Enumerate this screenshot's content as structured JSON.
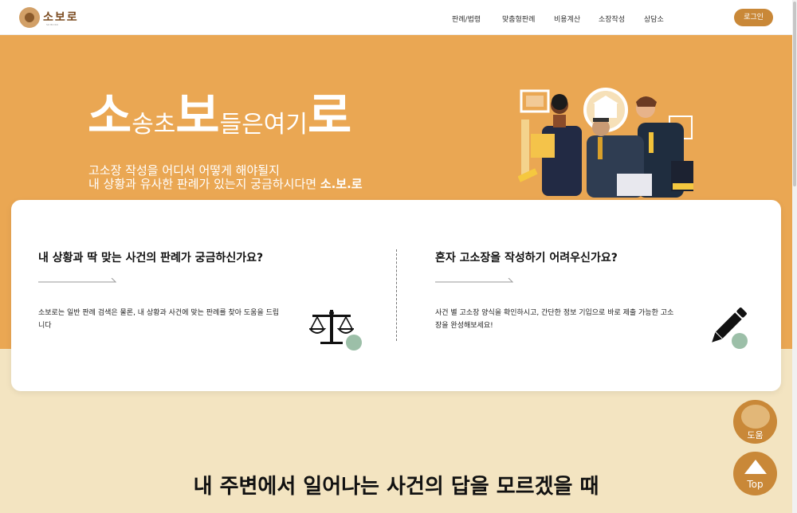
{
  "header": {
    "logo_text": "소보로",
    "logo_sub": "SO BO RO",
    "nav": [
      "판례/법령",
      "맞춤형판례",
      "비용계산",
      "소장작성",
      "상담소"
    ],
    "login": "로그인"
  },
  "hero": {
    "title_parts": [
      {
        "text": "소",
        "size": "big"
      },
      {
        "text": "송초",
        "size": "small"
      },
      {
        "text": "보",
        "size": "big"
      },
      {
        "text": "들은여기",
        "size": "small"
      },
      {
        "text": "로",
        "size": "big"
      }
    ],
    "subtitle_line1": "고소장 작성을 어디서 어떻게 해야될지",
    "subtitle_line2_prefix": "내 상황과 유사한 판례가 있는지 궁금하시다면 ",
    "subtitle_brand": "소.보.로"
  },
  "cards": [
    {
      "title": "내 상황과 딱 맞는 사건의 판례가 궁금하신가요?",
      "desc": "소보로는 일반 판례 검색은 물론, 내 상황과 사건에 맞는 판례를 찾아 도움을 드립니다",
      "icon": "scale-icon"
    },
    {
      "title": "혼자 고소장을 작성하기 어려우신가요?",
      "desc": "사건 별 고소장 양식을 확인하시고, 간단한 정보 기입으로 바로 제출 가능한 고소장을 완성해보세요!",
      "icon": "pencil-icon"
    }
  ],
  "bottom_heading": "내 주변에서 일어나는 사건의 답을 모르겠을 때",
  "floating": {
    "help": "도움",
    "top": "Top"
  },
  "colors": {
    "hero_bg": "#eaa753",
    "accent": "#c98838",
    "page_bg": "#f3e4c1",
    "icon_dot": "#9cbfa8"
  }
}
